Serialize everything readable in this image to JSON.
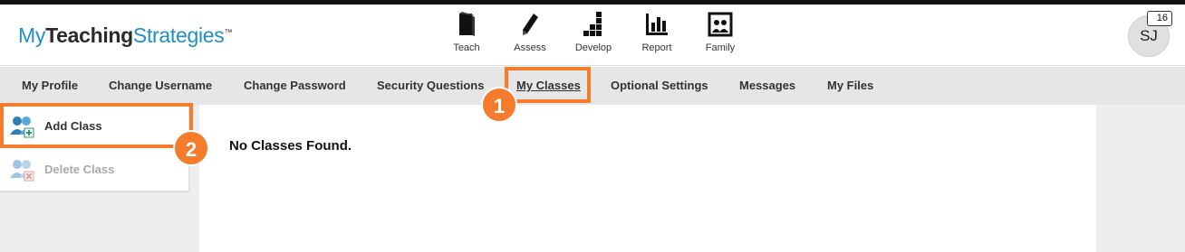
{
  "app": {
    "logo_prefix": "My",
    "logo_bold": "Teaching",
    "logo_suffix": "Strategies",
    "logo_tm": "™"
  },
  "topnav": [
    {
      "label": "Teach",
      "icon": "book-icon"
    },
    {
      "label": "Assess",
      "icon": "pencil-icon"
    },
    {
      "label": "Develop",
      "icon": "stairs-chart-icon"
    },
    {
      "label": "Report",
      "icon": "bar-chart-icon"
    },
    {
      "label": "Family",
      "icon": "family-photo-icon"
    }
  ],
  "user": {
    "initials": "SJ",
    "notification_count": "16"
  },
  "subnav": [
    {
      "label": "My Profile"
    },
    {
      "label": "Change Username"
    },
    {
      "label": "Change Password"
    },
    {
      "label": "Security Questions"
    },
    {
      "label": "My Classes",
      "active": true
    },
    {
      "label": "Optional Settings"
    },
    {
      "label": "Messages"
    },
    {
      "label": "My Files"
    }
  ],
  "sidebar": {
    "add_class": "Add Class",
    "delete_class": "Delete Class"
  },
  "content": {
    "empty_message": "No Classes Found."
  },
  "callouts": [
    {
      "number": "1"
    },
    {
      "number": "2"
    }
  ],
  "colors": {
    "accent": "#1f8fc9",
    "callout": "#f47c2c",
    "subnav_bg": "#e6e6e6"
  }
}
